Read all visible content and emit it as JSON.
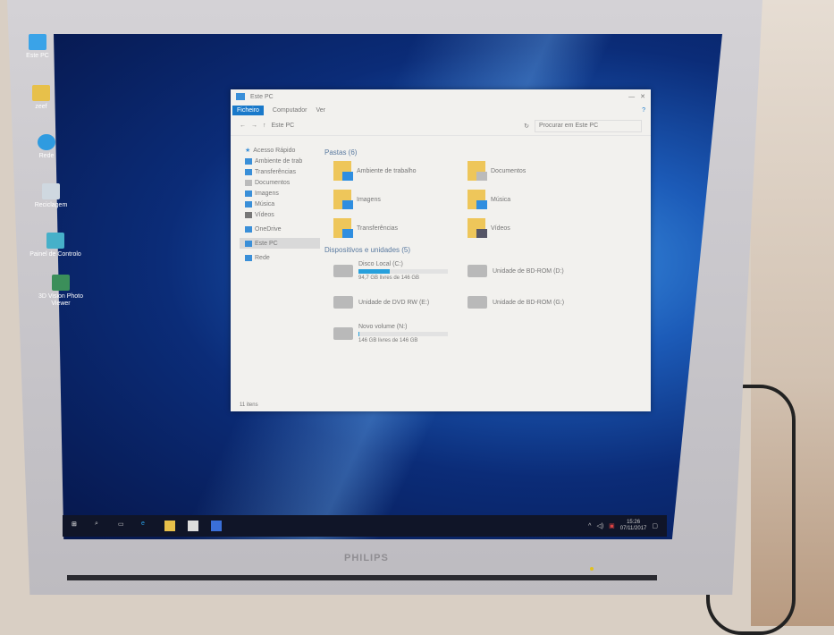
{
  "desktop": {
    "icons": [
      {
        "label": "Este PC",
        "color": "#3aa3e8"
      },
      {
        "label": "zeef",
        "color": "#e7c04a"
      },
      {
        "label": "Rede",
        "color": "#2f9be0"
      },
      {
        "label": "Reciclagem",
        "color": "#cfd8e0"
      },
      {
        "label": "Painel de Controlo",
        "color": "#46b0c9"
      },
      {
        "label": "3D Vision Photo Viewer",
        "color": "#3b8f5a"
      }
    ]
  },
  "explorer": {
    "title": "Este PC",
    "tabs": [
      "Ficheiro",
      "Computador",
      "Ver"
    ],
    "path": "Este PC",
    "search_placeholder": "Procurar em Este PC",
    "nav": [
      "Acesso Rápido",
      "Ambiente de trab",
      "Transferências",
      "Documentos",
      "Imagens",
      "Música",
      "Vídeos",
      "OneDrive",
      "Este PC",
      "Rede"
    ],
    "folders_header": "Pastas (6)",
    "folders": [
      "Ambiente de trabalho",
      "Documentos",
      "Imagens",
      "Música",
      "Transferências",
      "Vídeos"
    ],
    "devices_header": "Dispositivos e unidades (5)",
    "devices": [
      {
        "name": "Disco Local (C:)",
        "free": "94,7 GB livres de 146 GB",
        "used_pct": 35
      },
      {
        "name": "Unidade de BD-ROM (D:)"
      },
      {
        "name": "Unidade de DVD RW (E:)"
      },
      {
        "name": "Unidade de BD-ROM (G:)"
      },
      {
        "name": "Novo volume (N:)",
        "free": "146 GB livres de 146 GB",
        "used_pct": 1
      }
    ],
    "status": "11 itens"
  },
  "taskbar": {
    "time": "15:26",
    "date": "07/11/2017"
  },
  "monitor": {
    "brand": "PHILIPS"
  }
}
